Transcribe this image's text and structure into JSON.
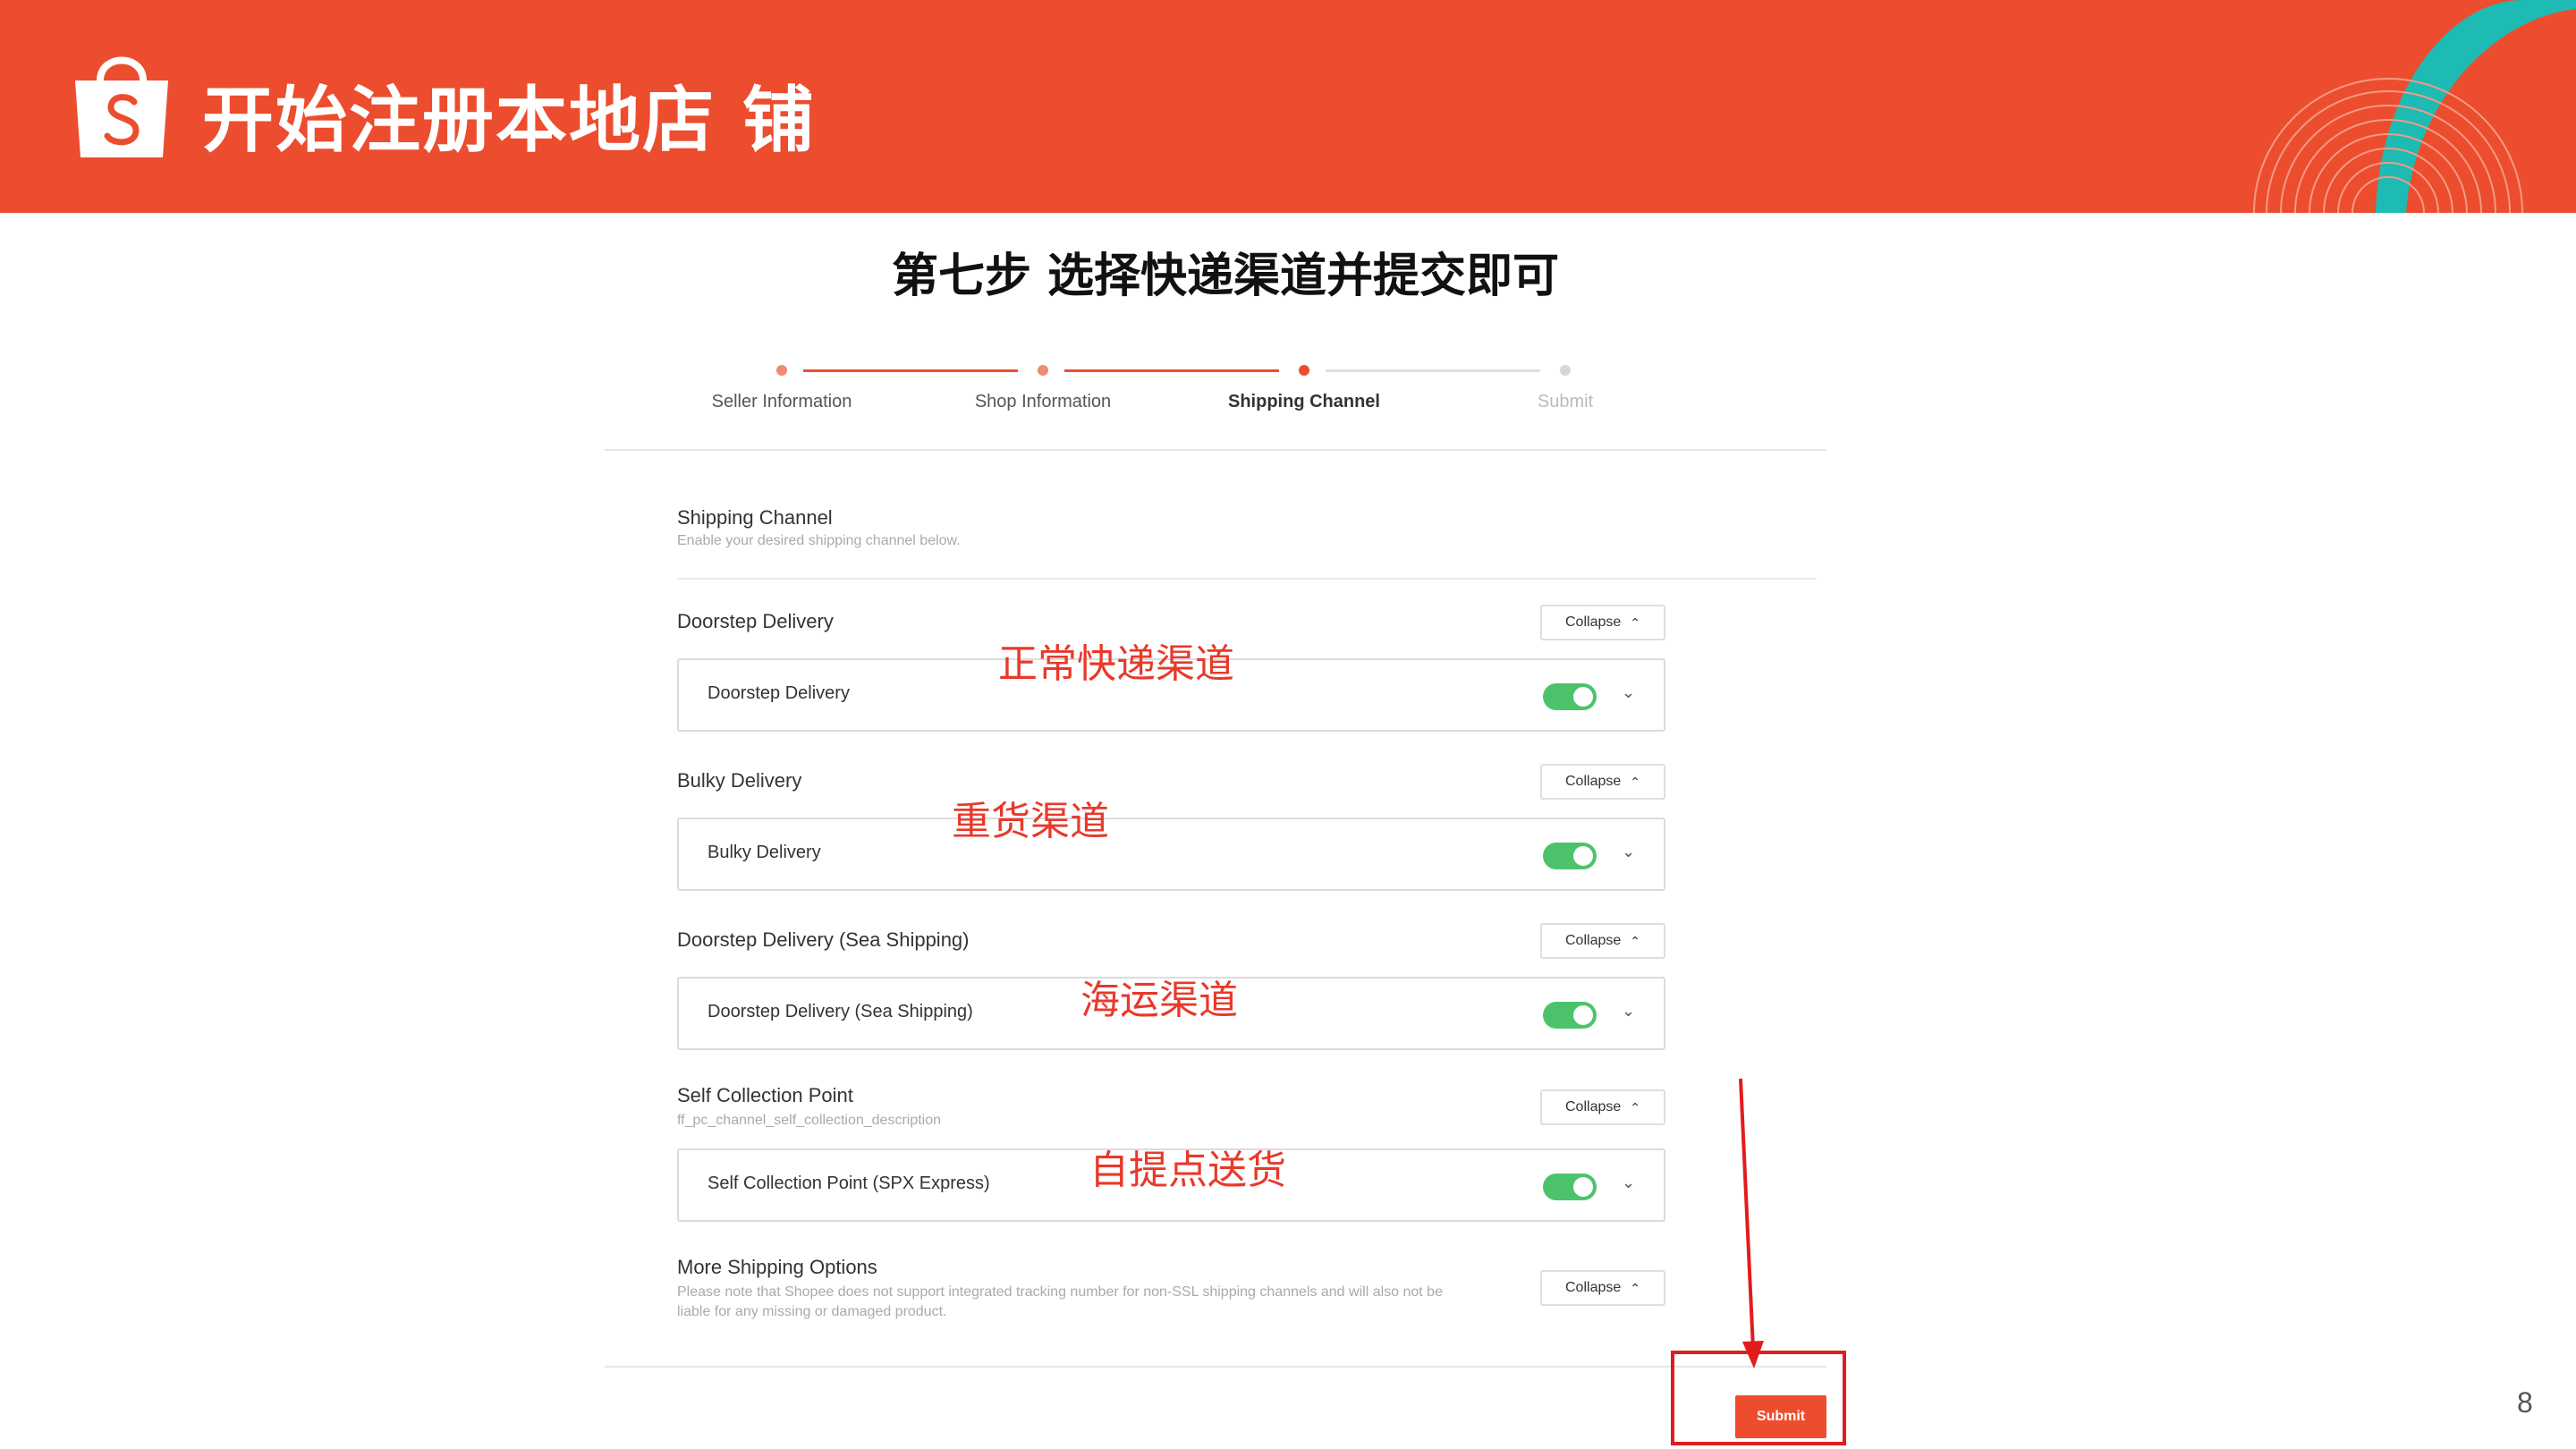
{
  "banner": {
    "title": "开始注册本地店 铺",
    "logo_icon": "shopee-bag-logo-icon",
    "background_color": "#ec4d2e"
  },
  "step_title": "第七步 选择快递渠道并提交即可",
  "stepper": {
    "steps": [
      {
        "label": "Seller Information",
        "state": "done"
      },
      {
        "label": "Shop Information",
        "state": "done"
      },
      {
        "label": "Shipping Channel",
        "state": "active"
      },
      {
        "label": "Submit",
        "state": "pending"
      }
    ],
    "active_color": "#ee4d2d",
    "pending_color": "#cccccc"
  },
  "shipping_channel": {
    "title": "Shipping Channel",
    "description": "Enable your desired shipping channel below."
  },
  "groups": [
    {
      "title": "Doorstep Delivery",
      "description": "",
      "collapse_label": "Collapse",
      "channel_label": "Doorstep Delivery",
      "enabled": true
    },
    {
      "title": "Bulky Delivery",
      "description": "",
      "collapse_label": "Collapse",
      "channel_label": "Bulky Delivery",
      "enabled": true
    },
    {
      "title": "Doorstep Delivery (Sea Shipping)",
      "description": "",
      "collapse_label": "Collapse",
      "channel_label": "Doorstep Delivery (Sea Shipping)",
      "enabled": true
    },
    {
      "title": "Self Collection Point",
      "description": "ff_pc_channel_self_collection_description",
      "collapse_label": "Collapse",
      "channel_label": "Self Collection Point (SPX Express)",
      "enabled": true
    }
  ],
  "more_options": {
    "title": "More Shipping Options",
    "description_line1": "Please note that Shopee does not support integrated tracking number for non-SSL shipping channels and will also not be",
    "description_line2": "liable for any missing or damaged product.",
    "collapse_label": "Collapse"
  },
  "annotations": [
    "正常快递渠道",
    "重货渠道",
    "海运渠道",
    "自提点送货"
  ],
  "submit_label": "Submit",
  "page_number": "8",
  "colors": {
    "accent": "#ee4d2d",
    "toggle_on": "#4cc36b",
    "annotation": "#e8392a",
    "highlight_frame": "#e21c1c"
  }
}
